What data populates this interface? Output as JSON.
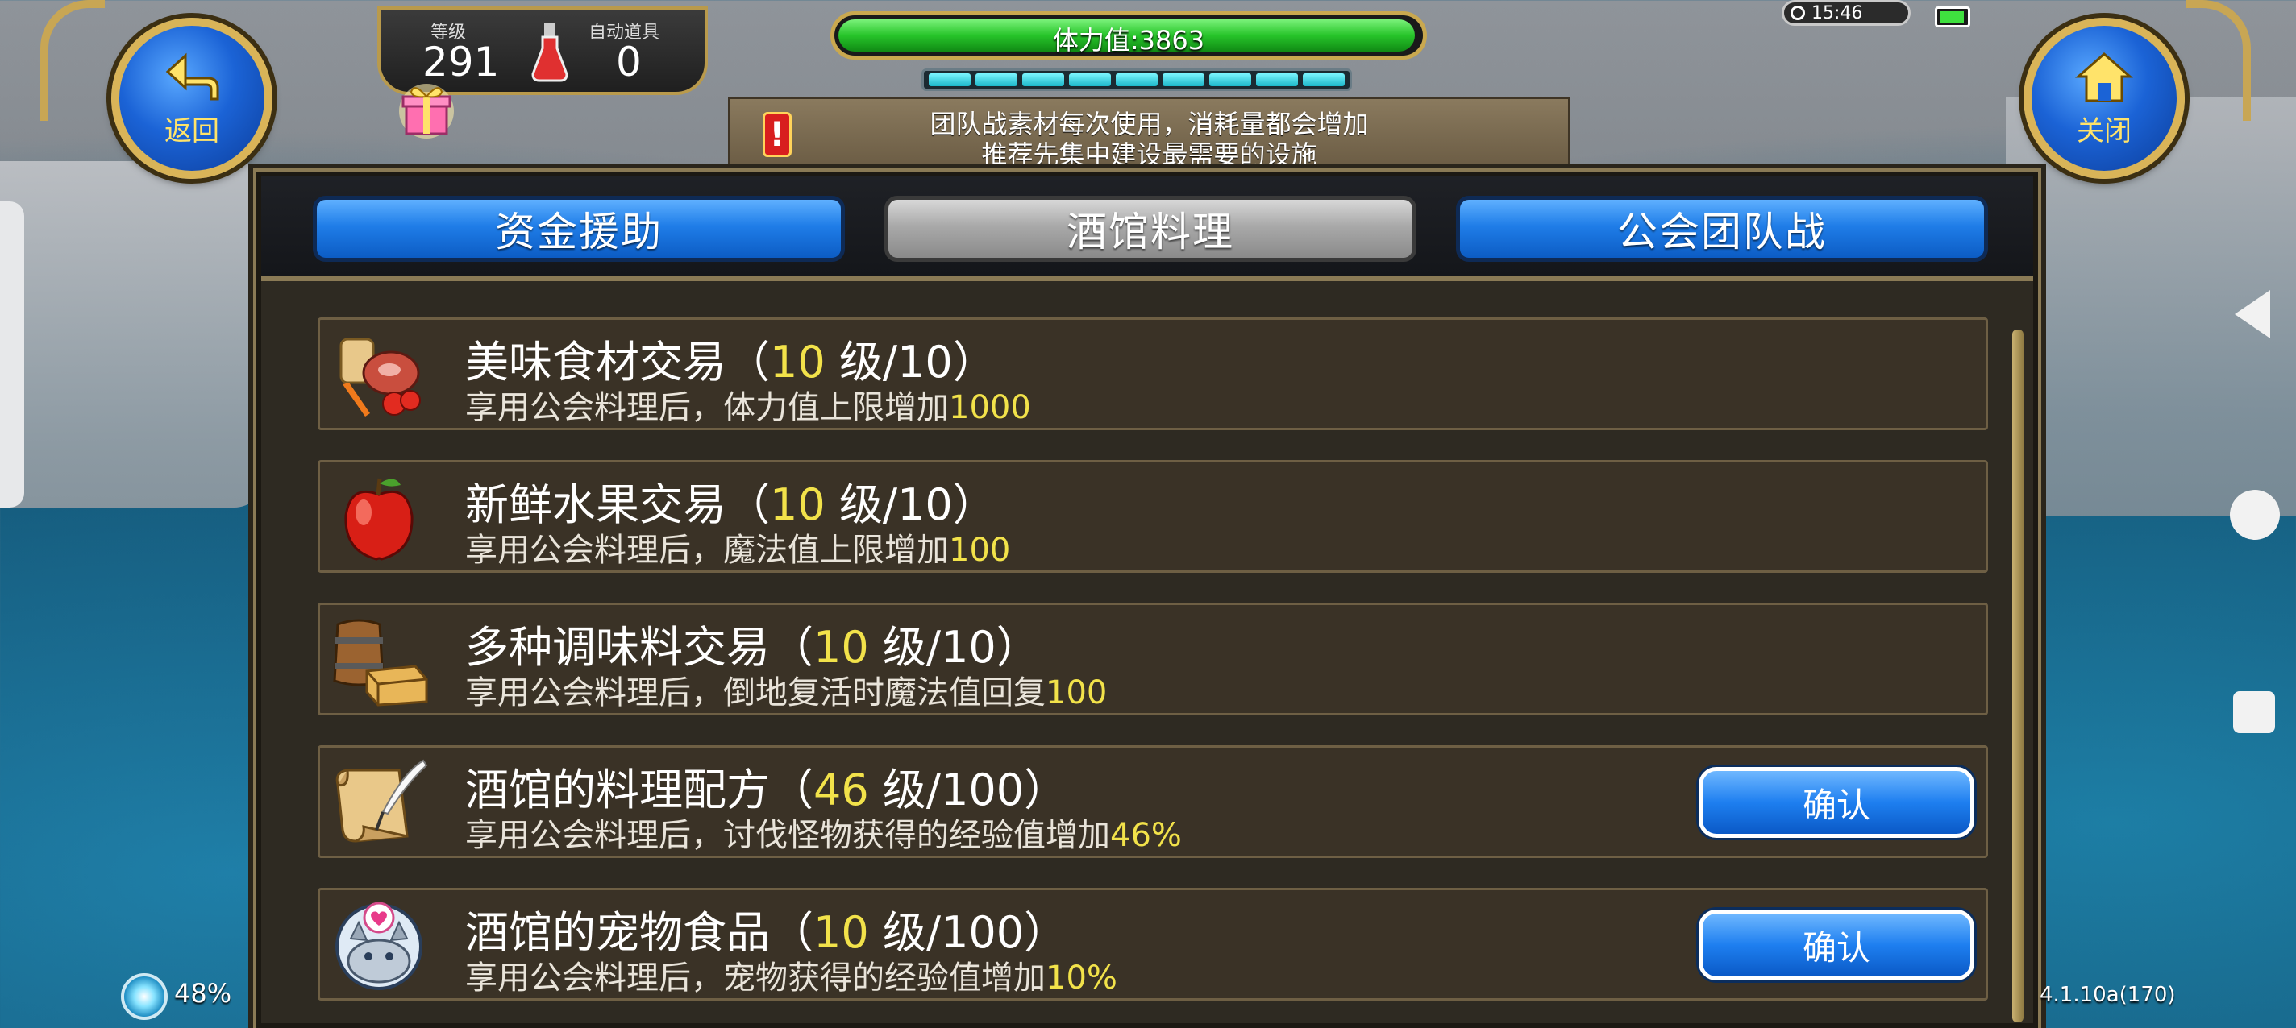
{
  "hud": {
    "back_label": "返回",
    "close_label": "关闭",
    "level_label": "等级",
    "level_value": "291",
    "auto_item_label": "自动道具",
    "auto_item_value": "0",
    "stamina_text": "体力值:3863",
    "stamina_fill": 0.98,
    "segments_count": 9,
    "clock": "15:46"
  },
  "notice": {
    "line1": "团队战素材每次使用，消耗量都会增加",
    "line2": "推荐先集中建设最需要的设施"
  },
  "tabs": [
    {
      "label": "资金援助",
      "state": "active"
    },
    {
      "label": "酒馆料理",
      "state": "selected"
    },
    {
      "label": "公会团队战",
      "state": "active"
    }
  ],
  "items": [
    {
      "icon": "food-basket-icon",
      "name": "美味食材交易（",
      "level": "10",
      "level_suffix": "  级/10）",
      "desc": "享用公会料理后，体力值上限增加",
      "desc_value": "1000",
      "button": ""
    },
    {
      "icon": "apple-icon",
      "name": "新鲜水果交易（",
      "level": "10",
      "level_suffix": "  级/10）",
      "desc": "享用公会料理后，魔法值上限增加",
      "desc_value": "100",
      "button": ""
    },
    {
      "icon": "barrel-crate-icon",
      "name": "多种调味料交易（",
      "level": "10",
      "level_suffix": "  级/10）",
      "desc": "享用公会料理后，倒地复活时魔法值回复",
      "desc_value": "100",
      "button": ""
    },
    {
      "icon": "scroll-quill-icon",
      "name": "酒馆的料理配方（",
      "level": "46",
      "level_suffix": "  级/100）",
      "desc": "享用公会料理后，讨伐怪物获得的经验值增加",
      "desc_value": "46%",
      "button": "确认"
    },
    {
      "icon": "pet-food-icon",
      "name": "酒馆的宠物食品（",
      "level": "10",
      "level_suffix": "  级/100）",
      "desc": "享用公会料理后，宠物获得的经验值增加",
      "desc_value": "10%",
      "button": "确认"
    }
  ],
  "footer": {
    "signal_pct": "48%",
    "version": "4.1.10a(170)"
  },
  "colors": {
    "accent_blue": "#1f7de8",
    "highlight_yellow": "#f2e24a",
    "stamina_green": "#27c42a",
    "frame_gold": "#c9a84f"
  }
}
